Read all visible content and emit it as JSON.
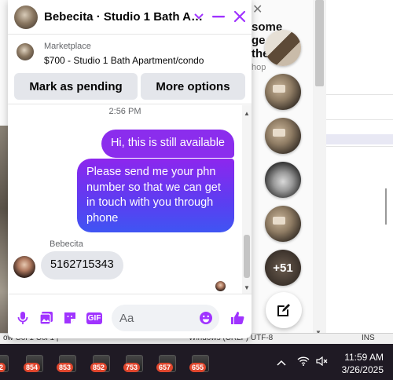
{
  "background": {
    "text_lines": [
      "some",
      "ge",
      "the"
    ],
    "shop_fragment": "hop",
    "statusbar": {
      "left_fragment": "ow   Col 1   Col 1   |",
      "mid_fragment": "Windows (CRLF)   UTF-8",
      "right": "INS"
    }
  },
  "chat": {
    "title": "Bebecita · Studio 1 Bath A…",
    "listing": {
      "source": "Marketplace",
      "title": "$700 - Studio 1 Bath Apartment/condo",
      "mark_pending_label": "Mark as pending",
      "more_options_label": "More options"
    },
    "timestamp": "2:56 PM",
    "messages": [
      {
        "from": "me",
        "text": "Hi, this is still available"
      },
      {
        "from": "me",
        "text": "Please send me your phn number so that we can get in touch with you through phone"
      },
      {
        "from": "Bebecita",
        "text": "5162715343"
      }
    ],
    "sender_name": "Bebecita",
    "composer": {
      "placeholder": "Aa",
      "gif_label": "GIF"
    }
  },
  "avatar_bar": {
    "more_count": "+51"
  },
  "taskbar": {
    "badges": [
      "2",
      "854",
      "853",
      "852",
      "753",
      "657",
      "655"
    ],
    "time": "11:59 AM",
    "date": "3/26/2025"
  },
  "colors": {
    "accent": "#8b2ded",
    "messenger_blue": "#0866ff",
    "icon_purple": "#a033ff"
  }
}
